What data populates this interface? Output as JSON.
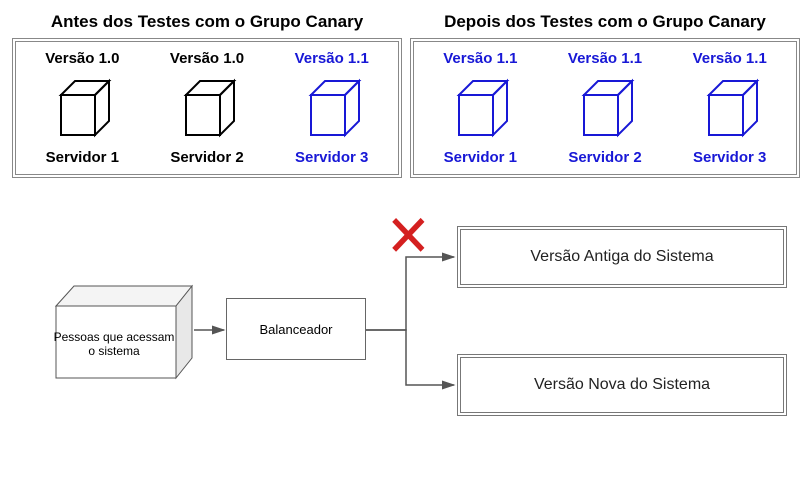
{
  "beforePanel": {
    "title": "Antes dos Testes com o Grupo Canary",
    "servers": [
      {
        "version": "Versão 1.0",
        "name": "Servidor 1",
        "color": "black"
      },
      {
        "version": "Versão 1.0",
        "name": "Servidor 2",
        "color": "black"
      },
      {
        "version": "Versão 1.1",
        "name": "Servidor 3",
        "color": "blue"
      }
    ]
  },
  "afterPanel": {
    "title": "Depois dos Testes com o Grupo Canary",
    "servers": [
      {
        "version": "Versão 1.1",
        "name": "Servidor 1",
        "color": "blue"
      },
      {
        "version": "Versão 1.1",
        "name": "Servidor 2",
        "color": "blue"
      },
      {
        "version": "Versão 1.1",
        "name": "Servidor 3",
        "color": "blue"
      }
    ]
  },
  "peopleBox": "Pessoas que acessam o sistema",
  "balancer": "Balanceador",
  "oldVersion": "Versão Antiga do Sistema",
  "newVersion": "Versão Nova do Sistema",
  "colors": {
    "blue": "#1818d6",
    "black": "#000000",
    "red": "#d42020"
  }
}
